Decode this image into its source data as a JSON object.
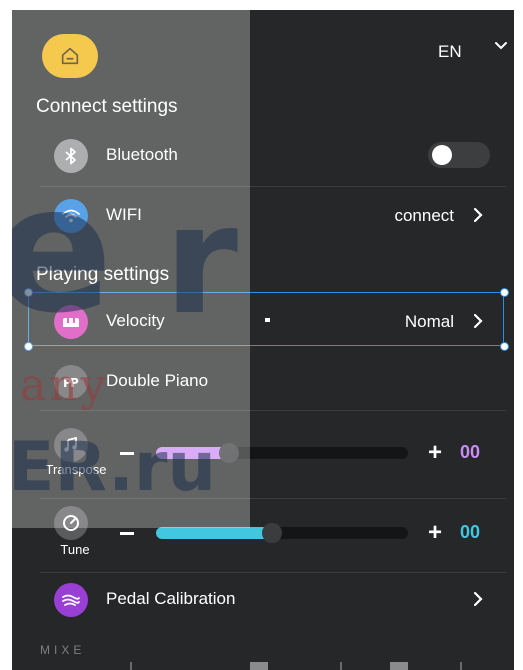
{
  "header": {
    "language": "EN"
  },
  "connect_settings": {
    "title": "Connect settings",
    "bluetooth": {
      "label": "Bluetooth"
    },
    "wifi": {
      "label": "WIFI",
      "value": "connect"
    }
  },
  "playing_settings": {
    "title": "Playing settings",
    "velocity": {
      "label": "Velocity",
      "value": "Nomal"
    },
    "double_piano": {
      "label": "Double Piano"
    },
    "transpose": {
      "label": "Transpose",
      "minus": "−",
      "plus": "+",
      "value": "00",
      "fill_fraction": 0.29
    },
    "tune": {
      "label": "Tune",
      "minus": "−",
      "plus": "+",
      "value": "00",
      "fill_fraction": 0.46
    },
    "pedal_calibration": {
      "label": "Pedal Calibration"
    }
  },
  "partial_footer_text": "MIXE",
  "colors": {
    "background": "#262728",
    "home_accent": "#f1b40b",
    "bluetooth_icon": "#8e8f91",
    "wifi_icon": "#1a7ee0",
    "velocity_icon": "#d637b4",
    "pedal_icon": "#9a3fd6",
    "transpose_accent": "#c98cf3",
    "tune_accent": "#43c6e0",
    "selection": "#2d8ee6"
  },
  "icons": {
    "home": "home-icon",
    "bluetooth": "bluetooth-icon",
    "wifi": "wifi-icon",
    "velocity": "piano-keys-icon",
    "double_piano": "double-piano-icon",
    "transpose": "music-note-icon",
    "tune": "tuning-icon",
    "pedal": "pedal-icon",
    "chevron": "chevron-right-icon"
  }
}
